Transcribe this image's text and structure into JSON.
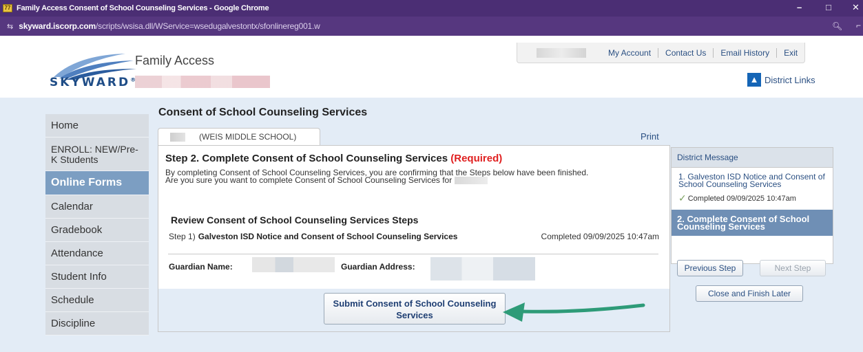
{
  "browser": {
    "window_title": "Family Access Consent of School Counseling Services - Google Chrome",
    "url_host": "skyward.iscorp.com",
    "url_path": "/scripts/wsisa.dll/WService=wsedugalvestontx/sfonlinereg001.w",
    "controls": {
      "minimize": "–",
      "maximize": "□",
      "close": "✕"
    }
  },
  "header": {
    "logo_text": "SKYWARD",
    "logo_mark": "®",
    "brand": "Family Access",
    "links": [
      "My Account",
      "Contact Us",
      "Email History",
      "Exit"
    ],
    "district_links": "District Links"
  },
  "nav": {
    "items": [
      "Home",
      "ENROLL: NEW/Pre-K Students",
      "Online Forms",
      "Calendar",
      "Gradebook",
      "Attendance",
      "Student Info",
      "Schedule",
      "Discipline"
    ],
    "active": "Online Forms"
  },
  "page": {
    "title": "Consent of School Counseling Services",
    "school_tab": "(WEIS MIDDLE SCHOOL)",
    "print": "Print"
  },
  "step": {
    "heading": "Step 2. Complete Consent of School Counseling Services",
    "required": "(Required)",
    "desc_line1": "By completing Consent of School Counseling Services, you are confirming that the Steps below have been finished.",
    "desc_line2": "Are you sure you want to complete Consent of School Counseling Services for",
    "review_title": "Review Consent of School Counseling Services Steps",
    "step_num": "Step 1)",
    "step_name": "Galveston ISD Notice and Consent of School Counseling Services",
    "step_done": "Completed 09/09/2025 10:47am",
    "guardian_name_label": "Guardian Name:",
    "guardian_address_label": "Guardian Address:",
    "submit_label": "Submit Consent of School Counseling Services"
  },
  "sidebar": {
    "heading": "District Message",
    "step1": "1. Galveston ISD Notice and Consent of School Counseling Services",
    "step1_done": "Completed 09/09/2025 10:47am",
    "step2": "2. Complete Consent of School Counseling Services",
    "previous": "Previous Step",
    "next": "Next Step",
    "close": "Close and Finish Later"
  },
  "colors": {
    "titlebar": "#4b2e74",
    "required": "#e02020",
    "active_nav": "#7c9ec2",
    "arrow": "#2e9b78"
  }
}
